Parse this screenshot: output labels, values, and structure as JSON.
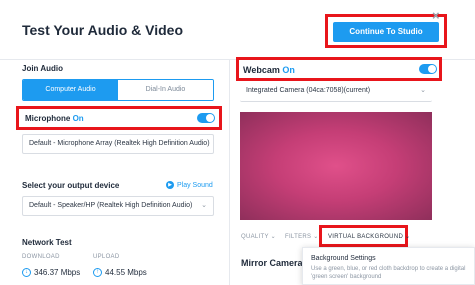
{
  "header": {
    "title": "Test Your Audio & Video",
    "continue_label": "Continue To Studio",
    "close_icon": "×"
  },
  "join_audio": {
    "label": "Join Audio",
    "tabs": [
      "Computer Audio",
      "Dial-In Audio"
    ],
    "active_tab": "Computer Audio"
  },
  "microphone": {
    "label": "Microphone",
    "state": "On",
    "enabled": true,
    "device": "Default - Microphone Array (Realtek High Definition Audio)"
  },
  "output": {
    "label": "Select your output device",
    "play_sound": "Play Sound",
    "device": "Default - Speaker/HP (Realtek High Definition Audio)"
  },
  "network": {
    "label": "Network Test",
    "download_label": "DOWNLOAD",
    "upload_label": "UPLOAD",
    "download_value": "346.37 Mbps",
    "upload_value": "44.55 Mbps"
  },
  "webcam": {
    "label": "Webcam",
    "state": "On",
    "enabled": true,
    "device": "Integrated Camera (04ca:7058)(current)"
  },
  "video_tabs": {
    "quality": "QUALITY ⌄",
    "filters": "FILTERS ⌄",
    "virtual_background": "VIRTUAL BACKGROUND ⌄"
  },
  "mirror": {
    "label": "Mirror Camera",
    "state": "O"
  },
  "tooltip": {
    "title": "Background Settings",
    "body": "Use a green, blue, or red cloth backdrop to create a digital 'green screen' background"
  },
  "colors": {
    "accent": "#1d9bf0",
    "highlight": "#e8151b"
  }
}
